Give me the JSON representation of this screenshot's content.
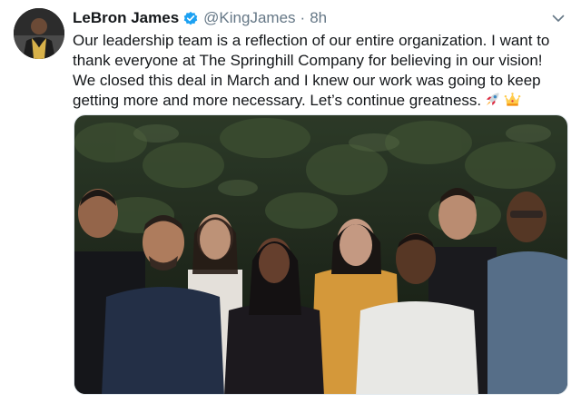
{
  "author": {
    "name": "LeBron James",
    "handle": "@KingJames",
    "separator": "·",
    "time": "8h"
  },
  "tweet": {
    "lines": [
      "Our leadership team is a reflection of our entire organization. I want to",
      "thank everyone at The Springhill Company for believing in our vision!",
      "We closed this deal in March and I knew our work was going to keep",
      "getting more and more necessary. Let’s continue greatness."
    ],
    "emojis": [
      "rocket-icon",
      "crown-icon"
    ]
  },
  "colors": {
    "verified": "#1da1f2",
    "text": "#14171a",
    "secondary": "#657786",
    "foliage": "#1f2a1c"
  }
}
